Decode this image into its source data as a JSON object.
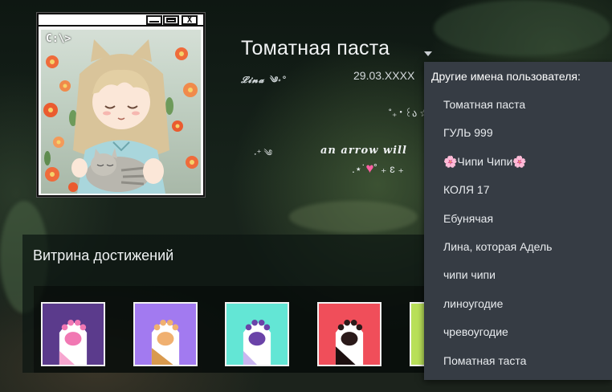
{
  "profile": {
    "name": "Томатная паста",
    "nick_line": "𝓛𝓲𝓷𝓪 ༄˖°",
    "date": "29.03.XXXX",
    "deco_line_1": "˚₊‧꒰ა ☆ 星",
    "deco_line_2": "˖⁺ ༄",
    "deco_line_3": "an arrow will",
    "deco_line_4_left": ".⋆˙",
    "deco_line_4_right": "˚ ₊ ɛ ₊"
  },
  "avatar": {
    "prompt": "C:\\>"
  },
  "showcase": {
    "title": "Витрина достижений",
    "badges": [
      {
        "name": "paw-badge-purple",
        "bg": "#5b3b8c",
        "paw": "#ffffff",
        "pads": "#f178b3",
        "accent": "#f6a6cf"
      },
      {
        "name": "paw-badge-lavender",
        "bg": "#a27af0",
        "paw": "#ffffff",
        "pads": "#f0b070",
        "accent": "#d99a4e"
      },
      {
        "name": "paw-badge-mint",
        "bg": "#63e6d5",
        "paw": "#ffffff",
        "pads": "#6a43a8",
        "accent": "#c9b6f0"
      },
      {
        "name": "paw-badge-red",
        "bg": "#f04e5a",
        "paw": "#ffffff",
        "pads": "#2a1a1a",
        "accent": "#1d1010"
      },
      {
        "name": "paw-badge-lime",
        "bg": "#b9e05a",
        "paw": "#ffffff",
        "pads": "#8a6a3a",
        "accent": "#6a5030"
      }
    ]
  },
  "dropdown": {
    "header": "Другие имена пользователя:",
    "items": [
      "Томатная паста",
      "ГУЛЬ 999",
      "🌸Чипи Чипи🌸",
      "КОЛЯ 17",
      "Ебунячая",
      "Лина, которая Адель",
      "чипи чипи",
      "линоугодие",
      "чревоугодие",
      "Поматная таста"
    ]
  },
  "colors": {
    "dropdown_bg": "#363c44",
    "panel_bg": "#0d1612",
    "text_primary": "#f1f3f4"
  }
}
